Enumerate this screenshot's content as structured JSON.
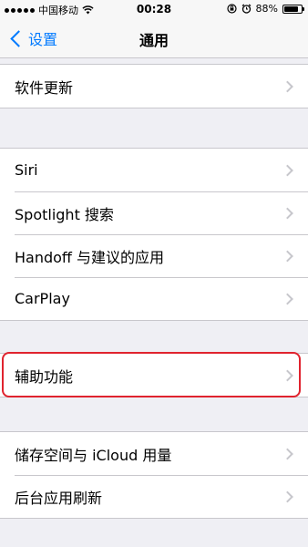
{
  "status_bar": {
    "carrier": "中国移动",
    "time": "00:28",
    "battery": "88%",
    "battery_level": 0.88
  },
  "nav": {
    "back_label": "设置",
    "title": "通用"
  },
  "sections": [
    {
      "items": [
        {
          "label": "软件更新"
        }
      ]
    },
    {
      "items": [
        {
          "label": "Siri"
        },
        {
          "label": "Spotlight 搜索"
        },
        {
          "label": "Handoff 与建议的应用"
        },
        {
          "label": "CarPlay"
        }
      ]
    },
    {
      "items": [
        {
          "label": "辅助功能",
          "highlighted": true
        }
      ]
    },
    {
      "items": [
        {
          "label": "储存空间与 iCloud 用量"
        },
        {
          "label": "后台应用刷新"
        }
      ]
    }
  ],
  "colors": {
    "accent": "#007aff",
    "highlight": "#e0232e",
    "background": "#efeff4"
  }
}
